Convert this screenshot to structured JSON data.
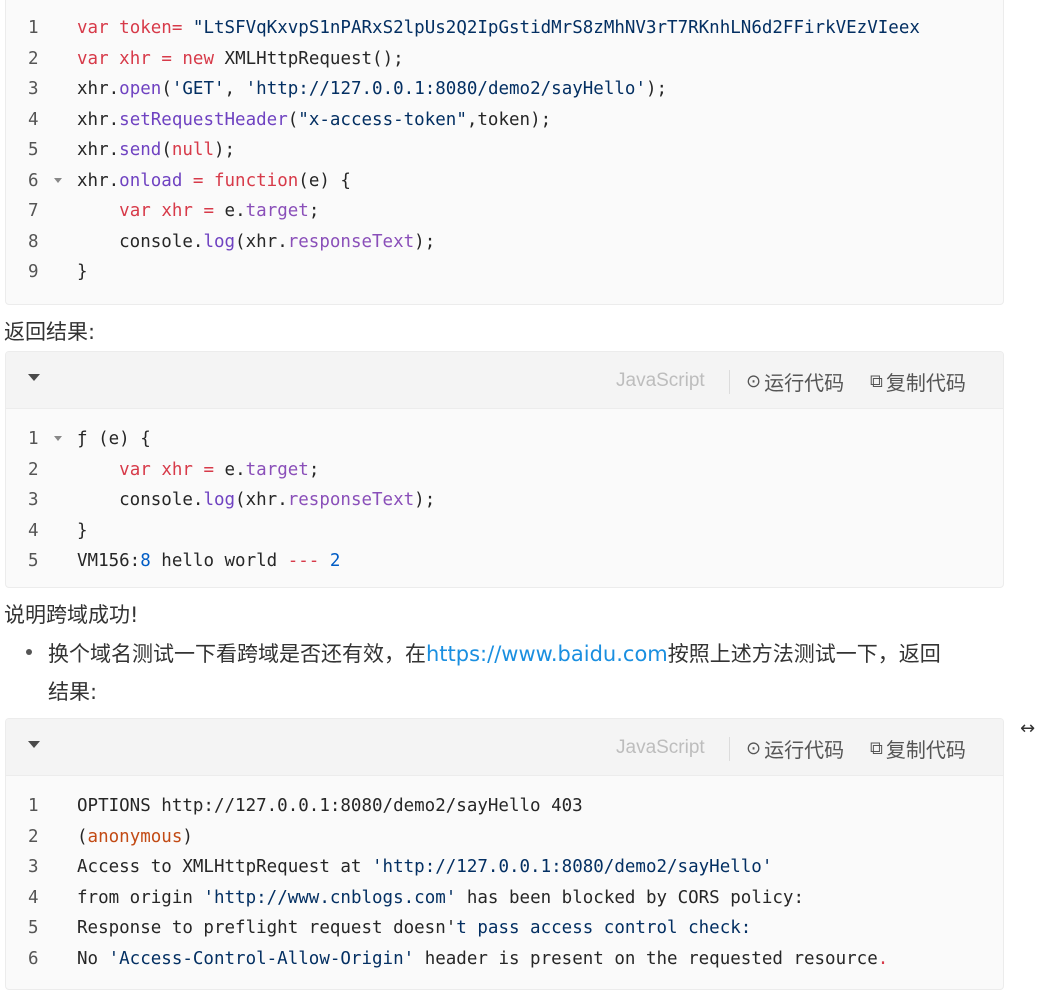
{
  "block1": {
    "lines": [
      {
        "n": "1",
        "fold": false,
        "parts": [
          [
            "kw",
            "var "
          ],
          [
            "kw",
            "token"
          ],
          [
            "kw",
            "= "
          ],
          [
            "str",
            "\"LtSFVqKxvpS1nPARxS2lpUs2Q2IpGstidMrS8zMhNV3rT7RKnhLN6d2FFirkVEzVIeex"
          ]
        ]
      },
      {
        "n": "2",
        "fold": false,
        "parts": [
          [
            "kw",
            "var "
          ],
          [
            "kw",
            "xhr "
          ],
          [
            "kw",
            "= "
          ],
          [
            "kw",
            "new "
          ],
          [
            "",
            "XMLHttpRequest();"
          ]
        ]
      },
      {
        "n": "3",
        "fold": false,
        "parts": [
          [
            "",
            "xhr."
          ],
          [
            "fn",
            "open"
          ],
          [
            "",
            "("
          ],
          [
            "str",
            "'GET'"
          ],
          [
            "",
            ", "
          ],
          [
            "str",
            "'http://127.0.0.1:8080/demo2/sayHello'"
          ],
          [
            "",
            ");"
          ]
        ]
      },
      {
        "n": "4",
        "fold": false,
        "parts": [
          [
            "",
            "xhr."
          ],
          [
            "fn",
            "setRequestHeader"
          ],
          [
            "",
            "("
          ],
          [
            "str",
            "\"x-access-token\""
          ],
          [
            "",
            ",token);"
          ]
        ]
      },
      {
        "n": "5",
        "fold": false,
        "parts": [
          [
            "",
            "xhr."
          ],
          [
            "fn",
            "send"
          ],
          [
            "",
            "("
          ],
          [
            "kw",
            "null"
          ],
          [
            "",
            ");"
          ]
        ]
      },
      {
        "n": "6",
        "fold": true,
        "parts": [
          [
            "",
            "xhr."
          ],
          [
            "fn",
            "onload"
          ],
          [
            "kw",
            " = "
          ],
          [
            "kw",
            "function"
          ],
          [
            "",
            "(e) {"
          ]
        ]
      },
      {
        "n": "7",
        "fold": false,
        "parts": [
          [
            "",
            "    "
          ],
          [
            "kw",
            "var "
          ],
          [
            "kw",
            "xhr "
          ],
          [
            "kw",
            "= "
          ],
          [
            "",
            "e."
          ],
          [
            "prop",
            "target"
          ],
          [
            "",
            ";"
          ]
        ]
      },
      {
        "n": "8",
        "fold": false,
        "parts": [
          [
            "",
            "    console."
          ],
          [
            "fn",
            "log"
          ],
          [
            "",
            "(xhr."
          ],
          [
            "prop",
            "responseText"
          ],
          [
            "",
            ");"
          ]
        ]
      },
      {
        "n": "9",
        "fold": false,
        "parts": [
          [
            "",
            "}"
          ]
        ]
      }
    ]
  },
  "text1": "返回结果:",
  "toolbar": {
    "language": "JavaScript",
    "run_label": "运行代码",
    "copy_label": "复制代码"
  },
  "block2": {
    "lines": [
      {
        "n": "1",
        "fold": true,
        "parts": [
          [
            "",
            "ƒ (e) {"
          ]
        ]
      },
      {
        "n": "2",
        "fold": false,
        "parts": [
          [
            "",
            "    "
          ],
          [
            "kw",
            "var "
          ],
          [
            "kw",
            "xhr "
          ],
          [
            "kw",
            "= "
          ],
          [
            "",
            "e."
          ],
          [
            "prop",
            "target"
          ],
          [
            "",
            ";"
          ]
        ]
      },
      {
        "n": "3",
        "fold": false,
        "parts": [
          [
            "",
            "    console."
          ],
          [
            "fn",
            "log"
          ],
          [
            "",
            "(xhr."
          ],
          [
            "prop",
            "responseText"
          ],
          [
            "",
            ");"
          ]
        ]
      },
      {
        "n": "4",
        "fold": false,
        "parts": [
          [
            "",
            "}"
          ]
        ]
      },
      {
        "n": "5",
        "fold": false,
        "parts": [
          [
            "",
            "VM156:"
          ],
          [
            "num2",
            "8"
          ],
          [
            "",
            " hello world "
          ],
          [
            "kw",
            "---"
          ],
          [
            "",
            " "
          ],
          [
            "num2",
            "2"
          ]
        ]
      }
    ]
  },
  "text2": "说明跨域成功!",
  "bullet": {
    "prefix": "换个域名测试一下看跨域是否还有效，在",
    "link": "https://www.baidu.com",
    "suffix": "按照上述方法测试一下，返回",
    "line2": "结果:"
  },
  "block3": {
    "lines": [
      {
        "n": "1",
        "fold": false,
        "parts": [
          [
            "",
            "OPTIONS http://127.0.0.1:8080/demo2/sayHello 403"
          ]
        ]
      },
      {
        "n": "2",
        "fold": false,
        "parts": [
          [
            "",
            "("
          ],
          [
            "anon",
            "anonymous"
          ],
          [
            "",
            ")"
          ]
        ]
      },
      {
        "n": "3",
        "fold": false,
        "parts": [
          [
            "",
            "Access to XMLHttpRequest at "
          ],
          [
            "str",
            "'http://127.0.0.1:8080/demo2/sayHello'"
          ]
        ]
      },
      {
        "n": "4",
        "fold": false,
        "parts": [
          [
            "",
            "from origin "
          ],
          [
            "str",
            "'http://www.cnblogs.com'"
          ],
          [
            "",
            " has been blocked by CORS policy:"
          ]
        ]
      },
      {
        "n": "5",
        "fold": false,
        "parts": [
          [
            "",
            "Response to preflight request doesn'"
          ],
          [
            "str",
            "t pass access control check:"
          ]
        ]
      },
      {
        "n": "6",
        "fold": false,
        "parts": [
          [
            "",
            "No "
          ],
          [
            "str",
            "'Access-Control-Allow-Origin'"
          ],
          [
            "",
            " header is present on the requested resource"
          ],
          [
            "kw",
            "."
          ]
        ]
      }
    ]
  },
  "side_icon": "expand-horizontal-icon",
  "side_icon_glyph": "↔"
}
